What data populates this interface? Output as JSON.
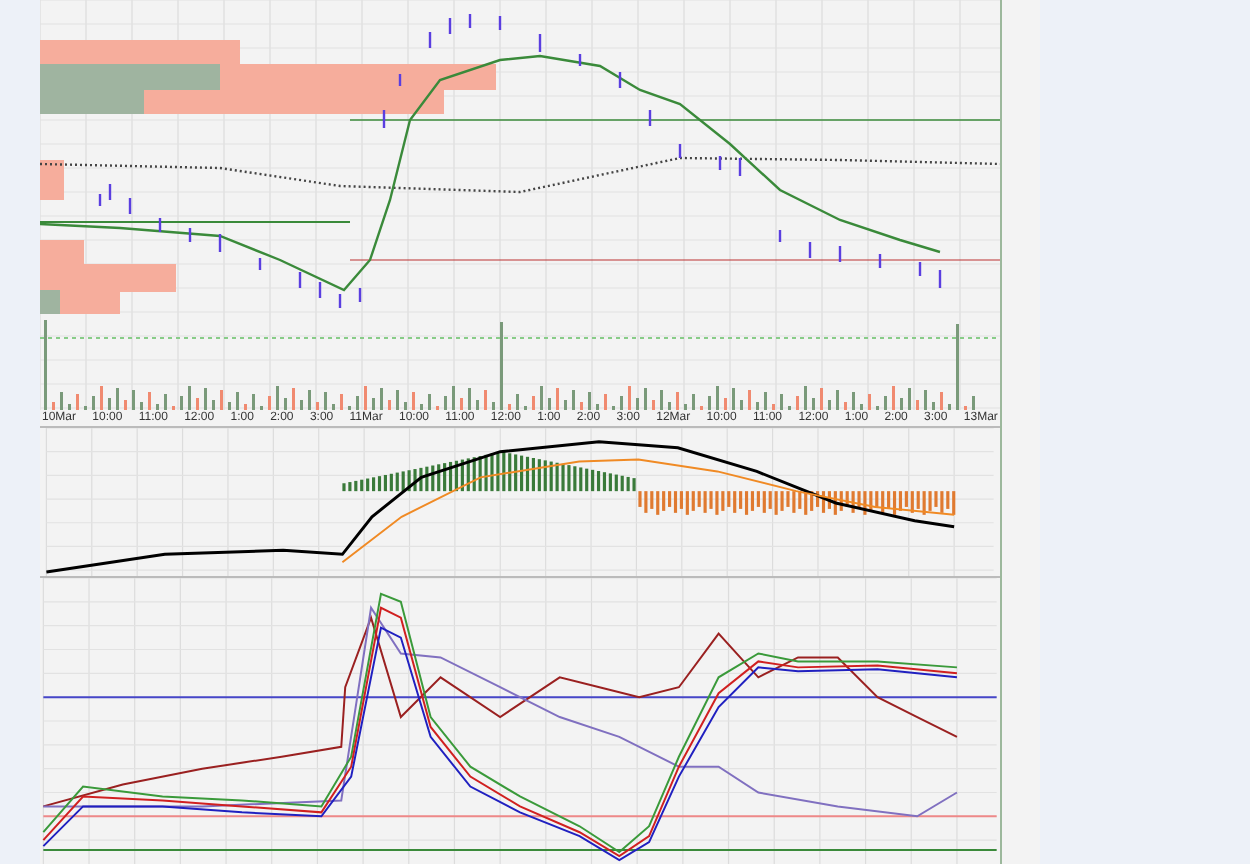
{
  "x_axis": {
    "labels": [
      "10Mar",
      "10:00",
      "11:00",
      "12:00",
      "1:00",
      "2:00",
      "3:00",
      "11Mar",
      "10:00",
      "11:00",
      "12:00",
      "1:00",
      "2:00",
      "3:00",
      "12Mar",
      "10:00",
      "11:00",
      "12:00",
      "1:00",
      "2:00",
      "3:00",
      "13Mar"
    ]
  }
}
